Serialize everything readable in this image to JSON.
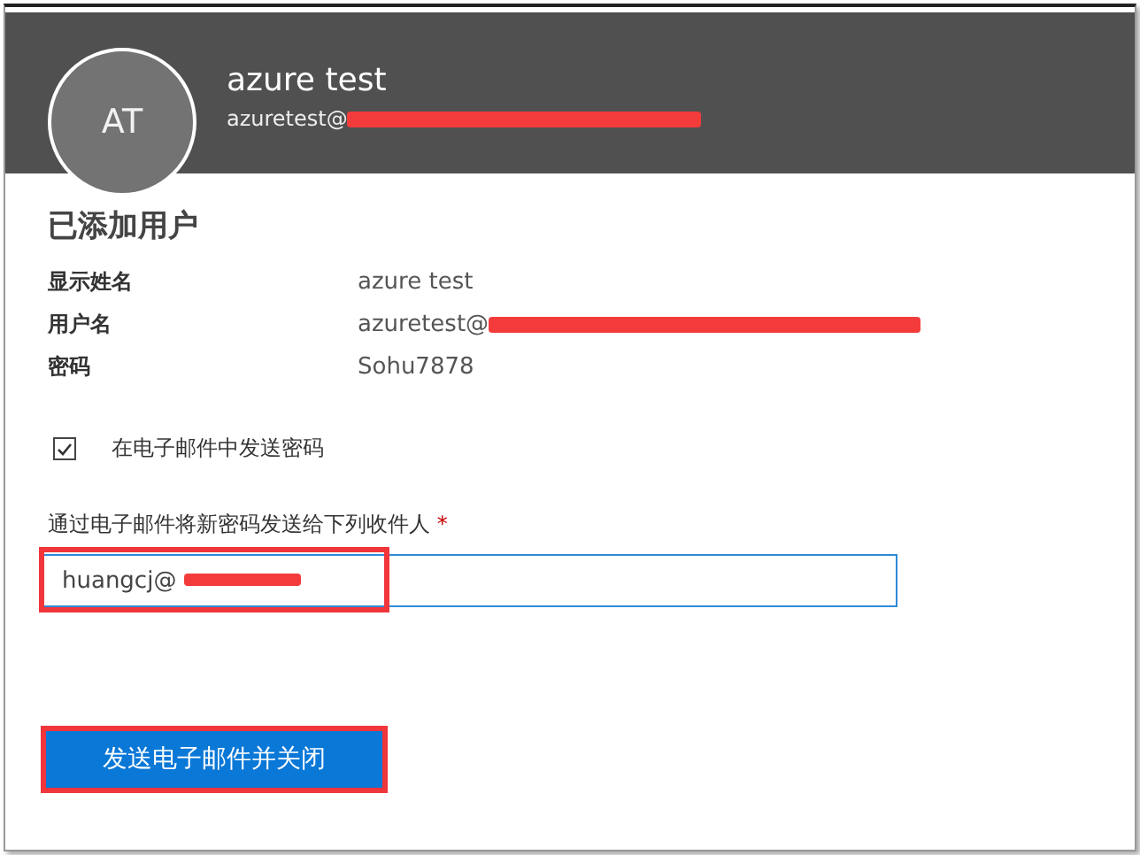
{
  "header": {
    "initials": "AT",
    "name": "azure test",
    "email": "azuretest@"
  },
  "title": "已添加用户",
  "details": [
    {
      "label": "显示姓名",
      "value": "azure test",
      "redacted": false
    },
    {
      "label": "用户名",
      "value": "azuretest@",
      "redacted": true
    },
    {
      "label": "密码",
      "value": "Sohu7878",
      "redacted": false
    }
  ],
  "send_password": {
    "label": "在电子邮件中发送密码",
    "checked": true
  },
  "recipients": {
    "label": "通过电子邮件将新密码发送给下列收件人",
    "required_mark": "*",
    "value": "huangcj@"
  },
  "button": "发送电子邮件并关闭"
}
